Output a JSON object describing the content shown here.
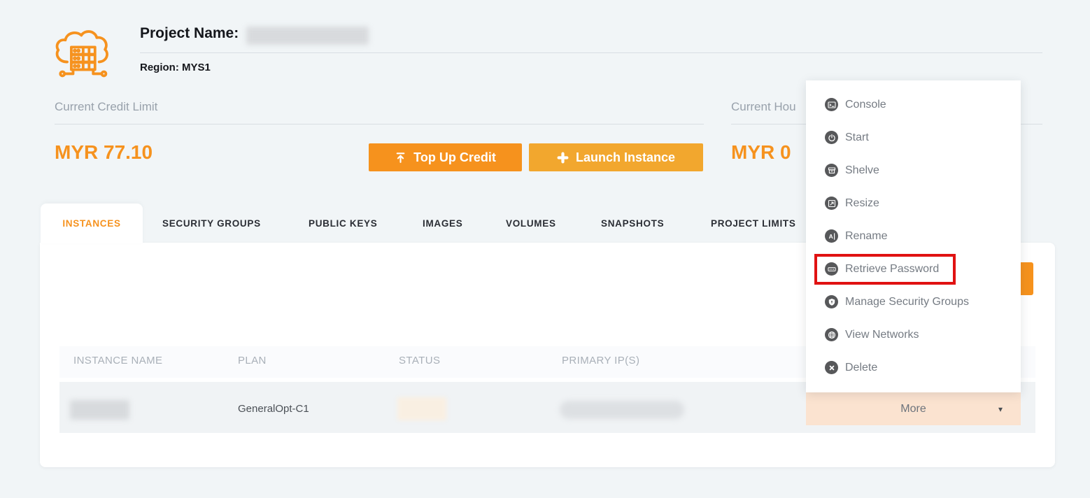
{
  "header": {
    "project_name_label": "Project Name:",
    "region": "Region: MYS1"
  },
  "billing": {
    "credit_label": "Current Credit Limit",
    "credit_amount": "MYR 77.10",
    "hourly_label_visible": "Current Hou",
    "hourly_amount_visible": "MYR 0"
  },
  "actions": {
    "top_up": "Top Up Credit",
    "launch": "Launch Instance"
  },
  "tabs": [
    {
      "label": "INSTANCES",
      "active": true
    },
    {
      "label": "SECURITY GROUPS"
    },
    {
      "label": "PUBLIC KEYS"
    },
    {
      "label": "IMAGES"
    },
    {
      "label": "VOLUMES"
    },
    {
      "label": "SNAPSHOTS"
    },
    {
      "label": "PROJECT LIMITS"
    }
  ],
  "instances_table": {
    "columns": [
      "INSTANCE NAME",
      "PLAN",
      "STATUS",
      "PRIMARY IP(S)"
    ],
    "rows": [
      {
        "instance_name": "",
        "plan": "GeneralOpt-C1",
        "status": "",
        "primary_ips": "",
        "action_label": "More",
        "redacted_fields": [
          "instance_name",
          "status",
          "primary_ips"
        ]
      }
    ]
  },
  "action_menu": {
    "items": [
      {
        "label": "Console",
        "icon": "console-icon"
      },
      {
        "label": "Start",
        "icon": "power-icon"
      },
      {
        "label": "Shelve",
        "icon": "shelve-icon"
      },
      {
        "label": "Resize",
        "icon": "resize-icon"
      },
      {
        "label": "Rename",
        "icon": "rename-icon"
      },
      {
        "label": "Retrieve Password",
        "icon": "password-icon",
        "highlighted": true
      },
      {
        "label": "Manage Security Groups",
        "icon": "shield-icon"
      },
      {
        "label": "View Networks",
        "icon": "globe-icon"
      },
      {
        "label": "Delete",
        "icon": "delete-icon"
      }
    ]
  },
  "ui": {
    "caret": "▾"
  },
  "colors": {
    "accent_orange": "#f6921e",
    "launch_yellow": "#f2a72e",
    "peach_button": "#fbe3d0",
    "highlight_red": "#e01212",
    "menu_icon_circle": "#57585a",
    "page_bg": "#f1f5f7"
  }
}
